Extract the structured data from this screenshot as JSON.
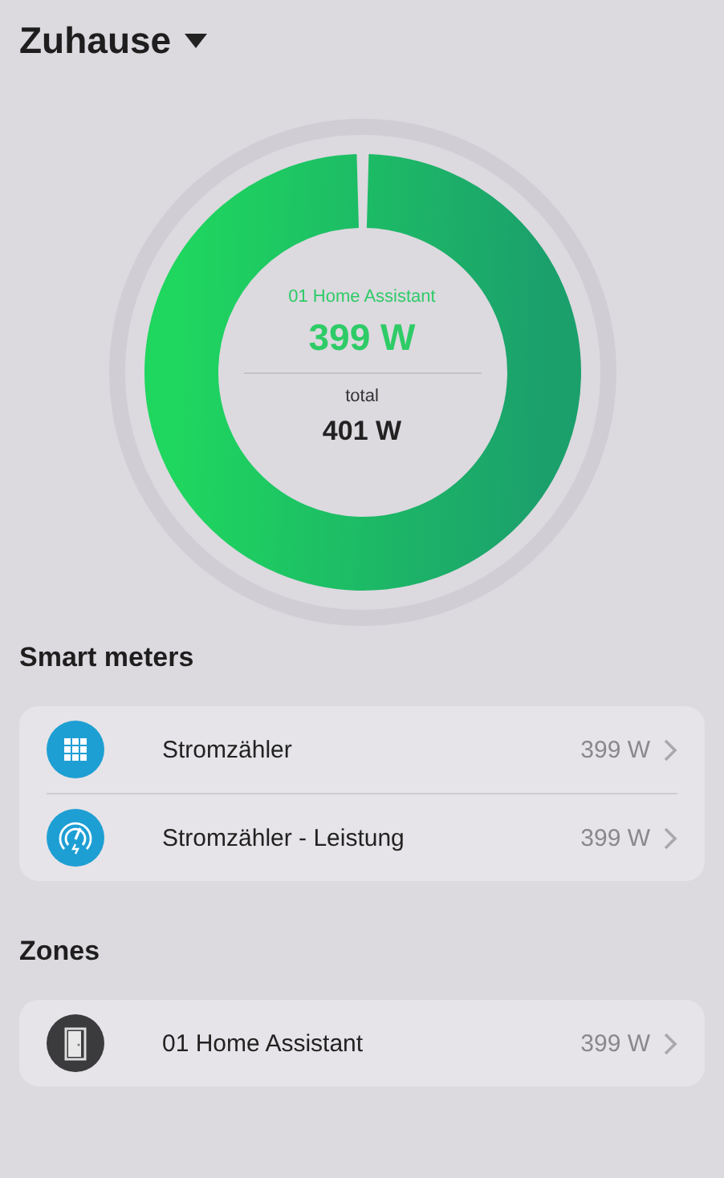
{
  "header": {
    "title": "Zuhause"
  },
  "donut": {
    "level": 0.995,
    "label": "01 Home Assistant",
    "value": "399 W",
    "total_label": "total",
    "total_value": "401 W"
  },
  "sections": [
    {
      "title": "Smart meters",
      "items": [
        {
          "kind": "grid",
          "name": "Stromzähler",
          "value": "399 W"
        },
        {
          "kind": "gauge",
          "name": "Stromzähler - Leistung",
          "value": "399 W"
        }
      ]
    },
    {
      "title": "Zones",
      "items": [
        {
          "kind": "door",
          "name": "01 Home Assistant",
          "value": "399 W"
        }
      ]
    }
  ]
}
